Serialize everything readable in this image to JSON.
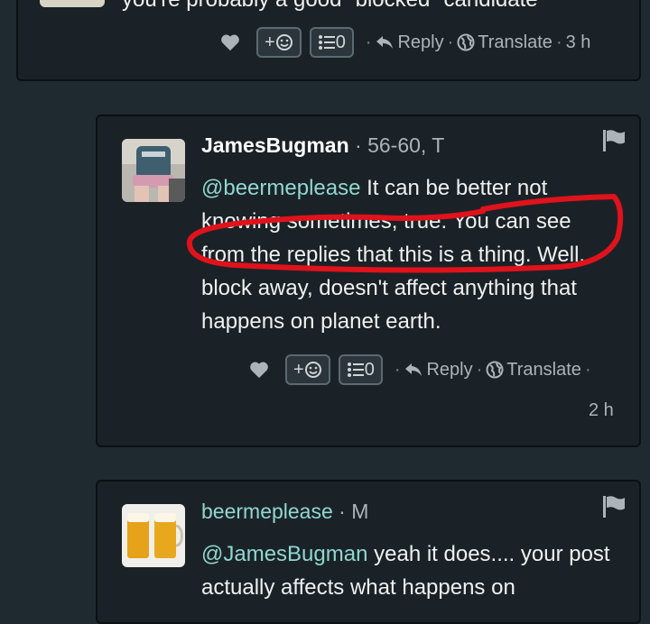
{
  "top_comment": {
    "partial_text": "you're probably a good \"blocked\" candidate",
    "reaction_add_label": "+☺",
    "list_label": "0",
    "reply_label": "Reply",
    "translate_label": "Translate",
    "time": "3 h"
  },
  "james_comment": {
    "username": "JamesBugman",
    "meta": "56-60, T",
    "mention": "@beermeplease",
    "text_rest": " It can be better not knowing sometimes, true. You can see from the replies that this is a thing. Well, block away, doesn't affect anything that happens on planet earth.",
    "reaction_add_label": "+☺",
    "list_label": "0",
    "reply_label": "Reply",
    "translate_label": "Translate",
    "time": "2 h",
    "annotation_color": "#e0121b"
  },
  "beer_comment": {
    "username": "beermeplease",
    "meta": "M",
    "mention": "@JamesBugman",
    "text_rest": " yeah it does.... your post actually affects what happens on"
  },
  "colors": {
    "background": "#1f2a30",
    "card": "#1b2227",
    "mention": "#8fd7d1"
  }
}
